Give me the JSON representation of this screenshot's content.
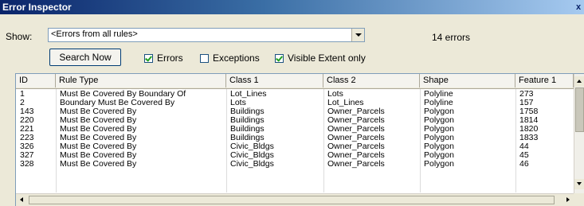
{
  "window": {
    "title": "Error Inspector",
    "close_glyph": "x"
  },
  "show": {
    "label": "Show:",
    "selected": "<Errors from all rules>"
  },
  "error_count": "14 errors",
  "search_button": "Search Now",
  "filters": [
    {
      "label": "Errors",
      "checked": true
    },
    {
      "label": "Exceptions",
      "checked": false
    },
    {
      "label": "Visible Extent only",
      "checked": true
    }
  ],
  "table": {
    "columns": [
      "ID",
      "Rule Type",
      "Class 1",
      "Class 2",
      "Shape",
      "Feature 1"
    ],
    "rows": [
      [
        "1",
        "Must Be Covered By Boundary Of",
        "Lot_Lines",
        "Lots",
        "Polyline",
        "273"
      ],
      [
        "2",
        "Boundary Must Be Covered By",
        "Lots",
        "Lot_Lines",
        "Polyline",
        "157"
      ],
      [
        "143",
        "Must Be Covered By",
        "Buildings",
        "Owner_Parcels",
        "Polygon",
        "1758"
      ],
      [
        "220",
        "Must Be Covered By",
        "Buildings",
        "Owner_Parcels",
        "Polygon",
        "1814"
      ],
      [
        "221",
        "Must Be Covered By",
        "Buildings",
        "Owner_Parcels",
        "Polygon",
        "1820"
      ],
      [
        "223",
        "Must Be Covered By",
        "Buildings",
        "Owner_Parcels",
        "Polygon",
        "1833"
      ],
      [
        "326",
        "Must Be Covered By",
        "Civic_Bldgs",
        "Owner_Parcels",
        "Polygon",
        "44"
      ],
      [
        "327",
        "Must Be Covered By",
        "Civic_Bldgs",
        "Owner_Parcels",
        "Polygon",
        "45"
      ],
      [
        "328",
        "Must Be Covered By",
        "Civic_Bldgs",
        "Owner_Parcels",
        "Polygon",
        "46"
      ]
    ]
  }
}
